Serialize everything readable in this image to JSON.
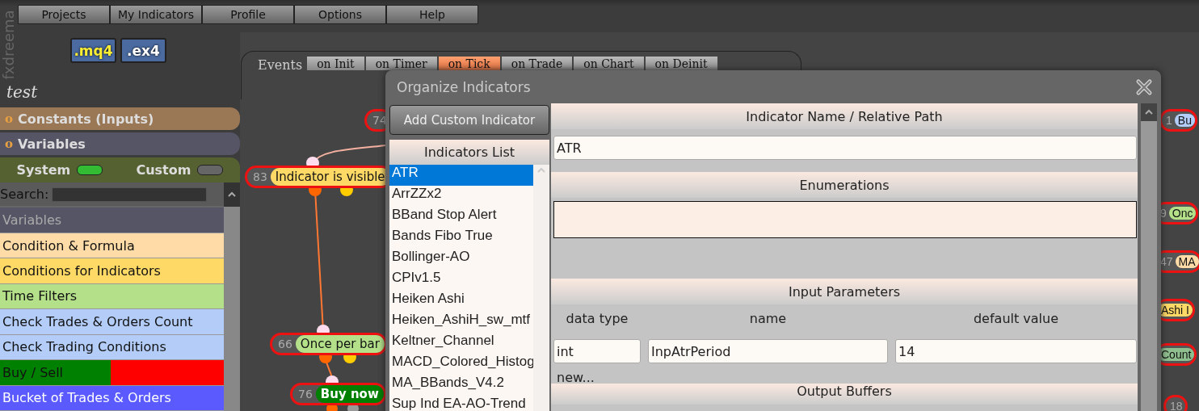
{
  "logo": "fxdreema",
  "menu": [
    {
      "label": "Projects"
    },
    {
      "label": "My Indicators"
    },
    {
      "label": "Profile"
    },
    {
      "label": "Options"
    },
    {
      "label": "Help"
    }
  ],
  "file_buttons": [
    {
      "label": ".mq4",
      "kind": "source"
    },
    {
      "label": ".ex4",
      "kind": "compiled"
    }
  ],
  "project_name": "test",
  "sections": [
    {
      "label": "Constants (Inputs)",
      "marker": "o",
      "color": "#9a7856"
    },
    {
      "label": "Variables",
      "marker": "o",
      "color": "#555566"
    }
  ],
  "toggles": [
    {
      "label": "System",
      "on": true
    },
    {
      "label": "Custom",
      "on": false
    }
  ],
  "search": {
    "label": "Search:"
  },
  "blocks": [
    {
      "label": "Variables",
      "kind": "header",
      "color": "#555566"
    },
    {
      "label": "Condition & Formula",
      "kind": "plain",
      "color": "#ffdba8"
    },
    {
      "label": "Conditions for Indicators",
      "kind": "plain",
      "color": "#ffd966"
    },
    {
      "label": "Time Filters",
      "kind": "plain",
      "color": "#b4e08a"
    },
    {
      "label": "Check Trades & Orders Count",
      "kind": "plain",
      "color": "#b3cdf8"
    },
    {
      "label": "Check Trading Conditions",
      "kind": "plain",
      "color": "#b3cdf8"
    },
    {
      "label": "Buy / Sell",
      "kind": "split",
      "color": "#008000"
    },
    {
      "label": "Bucket of Trades & Orders",
      "kind": "dark",
      "color": "#5a5aff"
    }
  ],
  "events": {
    "label": "Events",
    "tabs": [
      {
        "label": "on Init",
        "selected": false
      },
      {
        "label": "on Timer",
        "selected": false
      },
      {
        "label": "on Tick",
        "selected": true
      },
      {
        "label": "on Trade",
        "selected": false
      },
      {
        "label": "on Chart",
        "selected": false
      },
      {
        "label": "on Deinit",
        "selected": false
      }
    ]
  },
  "nodes": [
    {
      "number": "74"
    },
    {
      "number": "83",
      "label": "Indicator is visible",
      "color": "#ffd966"
    },
    {
      "number": "66",
      "label": "Once per bar",
      "color": "#b4e08a"
    },
    {
      "number": "76",
      "label": "Buy now",
      "color": "#008000"
    },
    {
      "number": "1",
      "label": "Bu",
      "color": "#b3cdf8"
    },
    {
      "number": "9",
      "label": "Onc",
      "color": "#b4e08a"
    },
    {
      "number": "47",
      "label": "MA",
      "color": "#ffdba8"
    },
    {
      "label": "Ashi I",
      "color": "#ffd966"
    },
    {
      "label": "Count",
      "color": "#8fbf8f"
    },
    {
      "number": "18"
    }
  ],
  "dialog": {
    "title": "Organize Indicators",
    "add_button": "Add Custom Indicator",
    "list_title": "Indicators List",
    "indicators": [
      {
        "label": "ATR",
        "selected": true
      },
      {
        "label": "ArrZZx2",
        "selected": false
      },
      {
        "label": "BBand Stop Alert",
        "selected": false
      },
      {
        "label": "Bands Fibo True",
        "selected": false
      },
      {
        "label": "Bollinger-AO",
        "selected": false
      },
      {
        "label": "CPIv1.5",
        "selected": false
      },
      {
        "label": "Heiken Ashi",
        "selected": false
      },
      {
        "label": "Heiken_AshiH_sw_mtf",
        "selected": false
      },
      {
        "label": "Keltner_Channel",
        "selected": false
      },
      {
        "label": "MACD_Colored_Histog",
        "selected": false
      },
      {
        "label": "MA_BBands_V4.2",
        "selected": false
      },
      {
        "label": "Sup Ind EA-AO-Trend",
        "selected": false
      }
    ],
    "name_section": {
      "title": "Indicator Name / Relative Path",
      "value": "ATR"
    },
    "enum_section": {
      "title": "Enumerations"
    },
    "params_section": {
      "title": "Input Parameters",
      "columns": [
        "data type",
        "name",
        "default value"
      ],
      "rows": [
        [
          "int",
          "InpAtrPeriod",
          "14"
        ]
      ],
      "new_link": "new..."
    },
    "output_section": {
      "title": "Output Buffers"
    }
  }
}
